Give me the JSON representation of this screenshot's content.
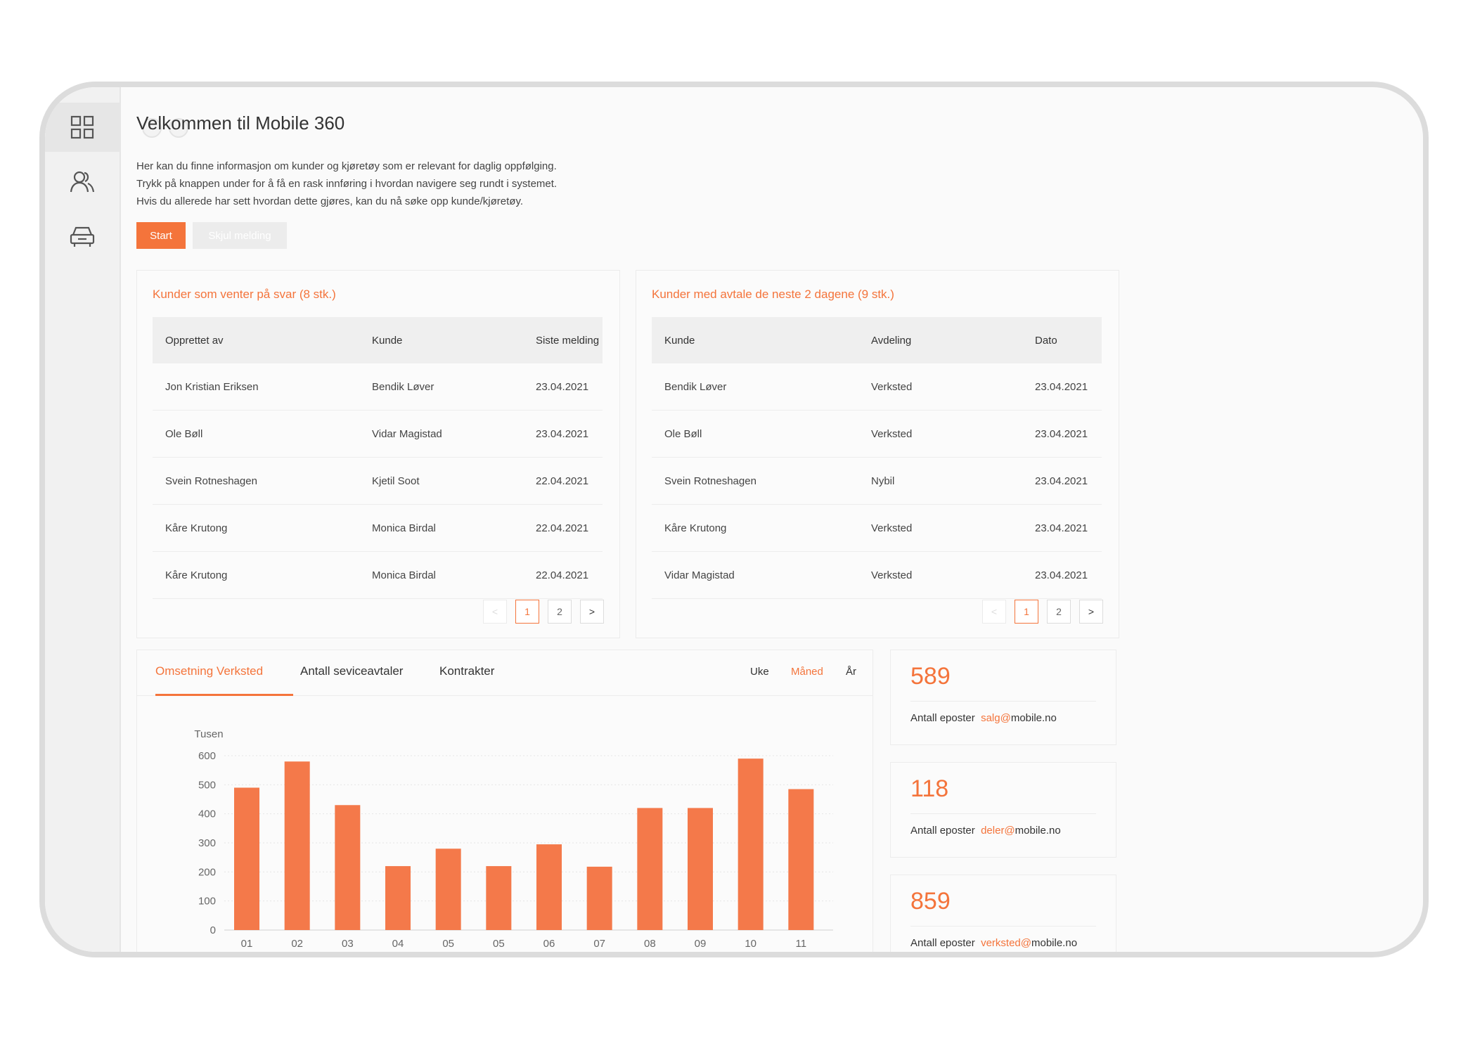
{
  "header": {
    "title": "Velkommen til Mobile 360",
    "intro_lines": [
      "Her kan du finne informasjon om kunder og kjøretøy som er relevant for daglig oppfølging.",
      "Trykk på knappen under for å få en rask innføring i hvordan navigere seg rundt i systemet.",
      "Hvis du allerede har sett hvordan dette gjøres, kan du nå søke opp kunde/kjøretøy."
    ],
    "start_button": "Start",
    "hide_button": "Skjul melding"
  },
  "sidebar": {
    "items": [
      "dashboard-icon",
      "customers-icon",
      "vehicle-icon"
    ]
  },
  "waiting": {
    "title": "Kunder som venter på svar (8 stk.)",
    "columns": [
      "Opprettet av",
      "Kunde",
      "Siste melding"
    ],
    "rows": [
      [
        "Jon Kristian Eriksen",
        "Bendik Løver",
        "23.04.2021"
      ],
      [
        "Ole Bøll",
        "Vidar Magistad",
        "23.04.2021"
      ],
      [
        "Svein Rotneshagen",
        "Kjetil Soot",
        "22.04.2021"
      ],
      [
        "Kåre Krutong",
        "Monica Birdal",
        "22.04.2021"
      ],
      [
        "Kåre Krutong",
        "Monica Birdal",
        "22.04.2021"
      ]
    ],
    "pager": {
      "prev": "<",
      "pages": [
        "1",
        "2"
      ],
      "next": ">"
    }
  },
  "appointments": {
    "title": "Kunder med avtale de neste 2 dagene (9 stk.)",
    "columns": [
      "Kunde",
      "Avdeling",
      "Dato"
    ],
    "rows": [
      [
        "Bendik Løver",
        "Verksted",
        "23.04.2021"
      ],
      [
        "Ole Bøll",
        "Verksted",
        "23.04.2021"
      ],
      [
        "Svein Rotneshagen",
        "Nybil",
        "23.04.2021"
      ],
      [
        "Kåre Krutong",
        "Verksted",
        "23.04.2021"
      ],
      [
        "Vidar Magistad",
        "Verksted",
        "23.04.2021"
      ]
    ],
    "pager": {
      "prev": "<",
      "pages": [
        "1",
        "2"
      ],
      "next": ">"
    }
  },
  "chart_tabs": {
    "tabs": [
      "Omsetning Verksted",
      "Antall seviceavtaler",
      "Kontrakter"
    ],
    "active_tab": "Omsetning Verksted",
    "periods": [
      "Uke",
      "Måned",
      "År"
    ],
    "active_period": "Måned"
  },
  "chart_data": {
    "type": "bar",
    "ylabel": "Tusen",
    "ylim": [
      0,
      600
    ],
    "yticks": [
      0,
      100,
      200,
      300,
      400,
      500,
      600
    ],
    "categories": [
      "01",
      "02",
      "03",
      "04",
      "05",
      "05",
      "06",
      "07",
      "08",
      "09",
      "10",
      "11"
    ],
    "values": [
      490,
      580,
      430,
      220,
      280,
      220,
      295,
      218,
      420,
      420,
      590,
      485
    ],
    "color": "#f4794a",
    "grid": true
  },
  "stats": [
    {
      "value": "589",
      "label": "Antall eposter",
      "email_highlight": "salg@",
      "email_rest": "mobile.no"
    },
    {
      "value": "118",
      "label": "Antall eposter",
      "email_highlight": "deler@",
      "email_rest": "mobile.no"
    },
    {
      "value": "859",
      "label": "Antall eposter",
      "email_highlight": "verksted@",
      "email_rest": "mobile.no"
    }
  ],
  "colors": {
    "accent": "#f4743b",
    "sidebar": "#f1f1f1"
  }
}
